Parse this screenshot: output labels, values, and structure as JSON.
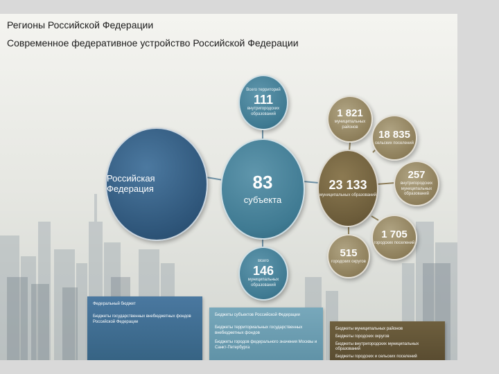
{
  "slide": {
    "title": "Регионы Российской Федерации",
    "subtitle": "Современное федеративное устройство Российской Федерации"
  },
  "colors": {
    "federal": "#2e5579",
    "regional": "#3f7a92",
    "municipal": "#8e7f5b",
    "municipal_total": "#6d5d3b"
  },
  "diagram": {
    "federation": {
      "label": "Российская Федерация"
    },
    "subjects": {
      "value": "83",
      "label": "субъекта"
    },
    "intra_city": {
      "caption": "Всего территорий",
      "value": "111",
      "label": "внутригородских образований"
    },
    "municipal_total_small": {
      "caption": "Всего",
      "value": "146",
      "label": "муниципальных образований"
    },
    "municipal_total": {
      "value": "23 133",
      "label": "муниципальных образований"
    },
    "satellites": [
      {
        "key": "c-1821",
        "value": "1 821",
        "label": "муниципальных районов"
      },
      {
        "key": "c-18835",
        "value": "18 835",
        "label": "сельских поселений"
      },
      {
        "key": "c-257",
        "value": "257",
        "label": "внутригородских муниципальных образований"
      },
      {
        "key": "c-1705",
        "value": "1 705",
        "label": "городских поселений"
      },
      {
        "key": "c-515",
        "value": "515",
        "label": "городских округов"
      }
    ]
  },
  "boxes": {
    "federal": {
      "title": "Федеральный бюджет",
      "text": "Бюджеты государственных внебюджетных фондов Российской Федерации"
    },
    "subjects": {
      "title": "Бюджеты субъектов Российской Федерации",
      "line1": "Бюджеты территориальных государственных внебюджетных фондов",
      "line2": "Бюджеты городов федерального значения Москвы и Санкт-Петербурга"
    },
    "municipal": {
      "title": "Бюджеты муниципальных районов",
      "line1": "Бюджеты городских округов",
      "line2": "Бюджеты внутригородских муниципальных образований",
      "line3": "Бюджеты городских и сельских поселений"
    }
  }
}
